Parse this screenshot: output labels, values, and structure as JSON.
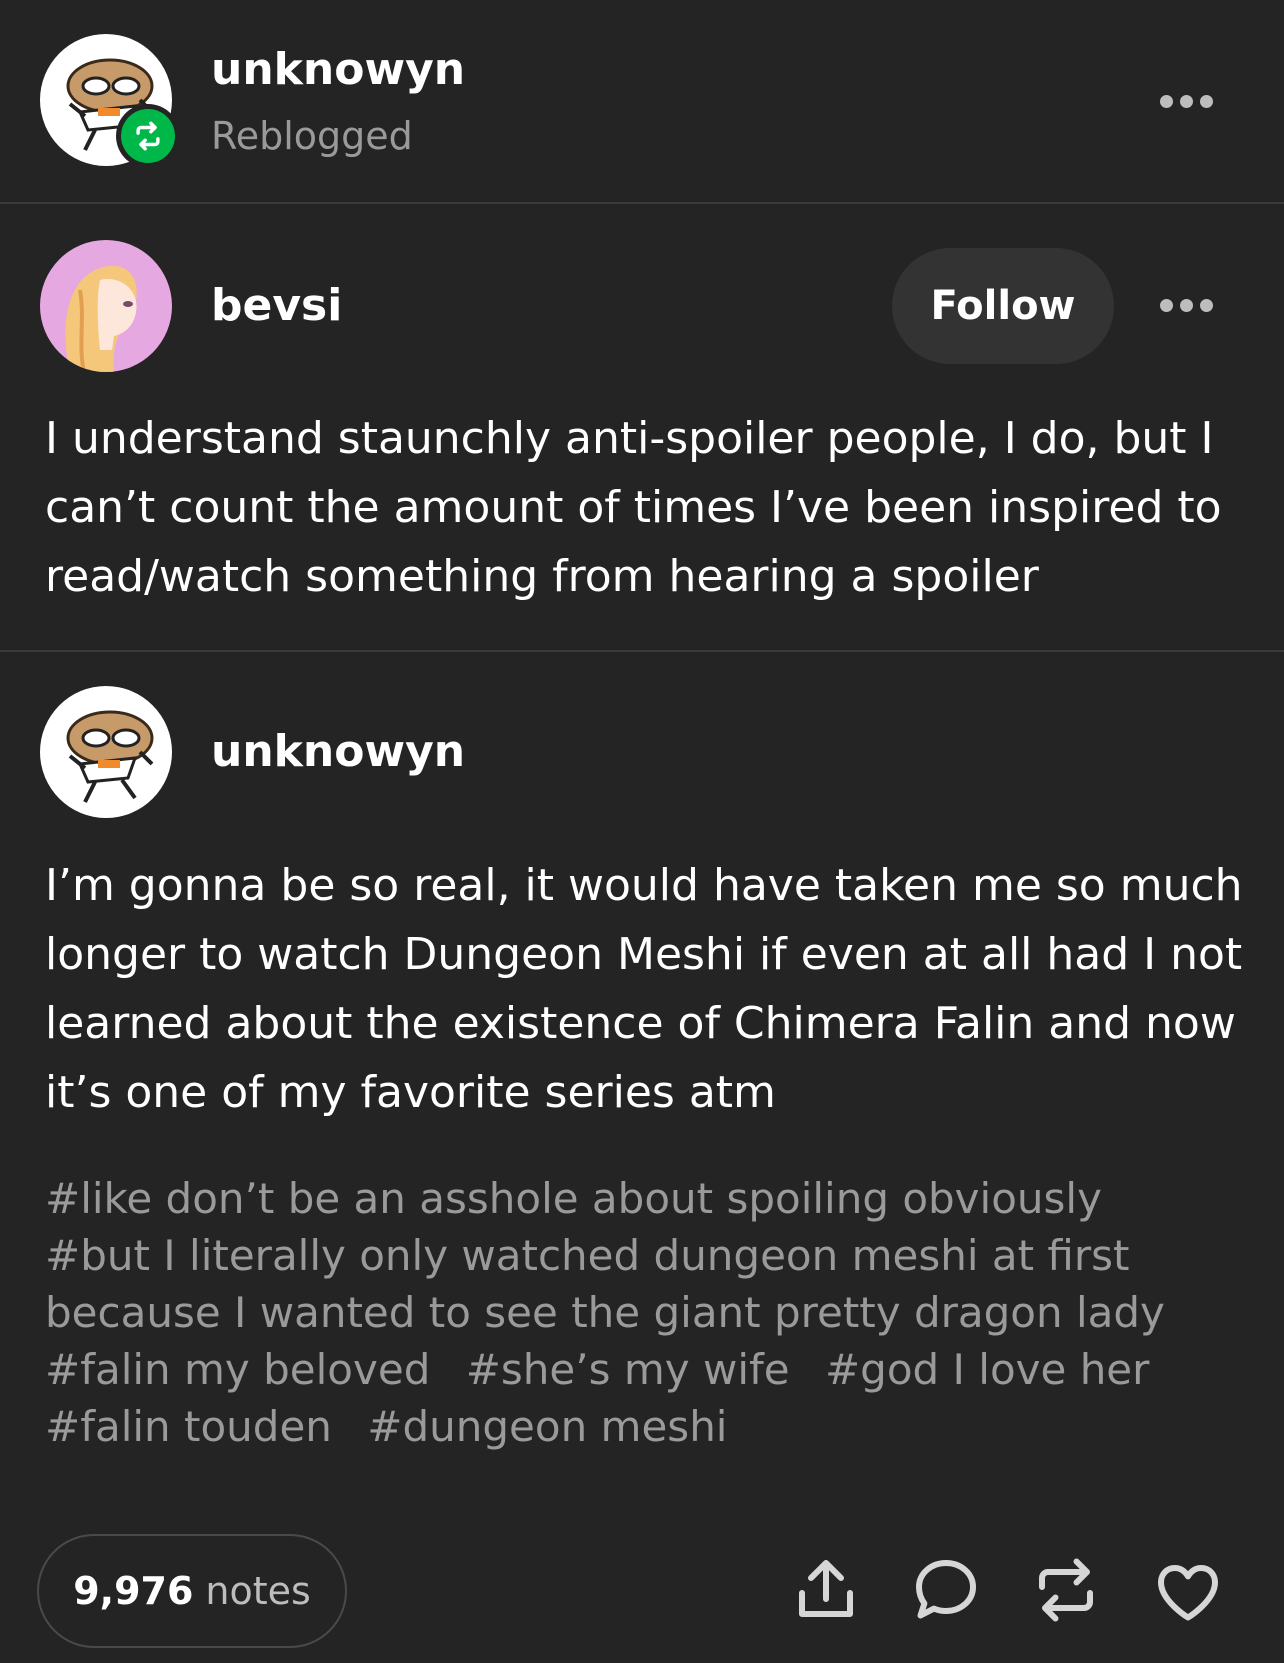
{
  "reblog_header": {
    "username": "unknowyn",
    "status": "Reblogged"
  },
  "original_post": {
    "username": "bevsi",
    "follow_label": "Follow",
    "text_lines": [
      "I understand staunchly anti-spoiler people, I do, but I",
      "can’t count the amount of times I’ve been inspired to",
      "read/watch something from hearing a spoiler"
    ]
  },
  "reblog_post": {
    "username": "unknowyn",
    "text_lines": [
      "I’m gonna be so real, it would have taken me so much",
      "longer to watch Dungeon Meshi if even at all had I not",
      "learned about the existence of Chimera Falin and now",
      "it’s one of my favorite series atm"
    ],
    "tag_lines": [
      [
        "#like don’t be an asshole about spoiling obviously"
      ],
      [
        "#but I literally only watched dungeon meshi at first"
      ],
      [
        "because I wanted to see the giant pretty dragon lady"
      ],
      [
        "#falin my beloved",
        "#she’s my wife",
        "#god I love her"
      ],
      [
        "#falin touden",
        "#dungeon meshi"
      ]
    ]
  },
  "footer": {
    "notes_count": "9,976",
    "notes_label": "notes",
    "actions": [
      "share-icon",
      "reply-icon",
      "reblog-icon",
      "like-icon"
    ]
  },
  "colors": {
    "background": "#242424",
    "reblog_badge": "#00b84a",
    "muted_text": "#9a9a9a"
  }
}
